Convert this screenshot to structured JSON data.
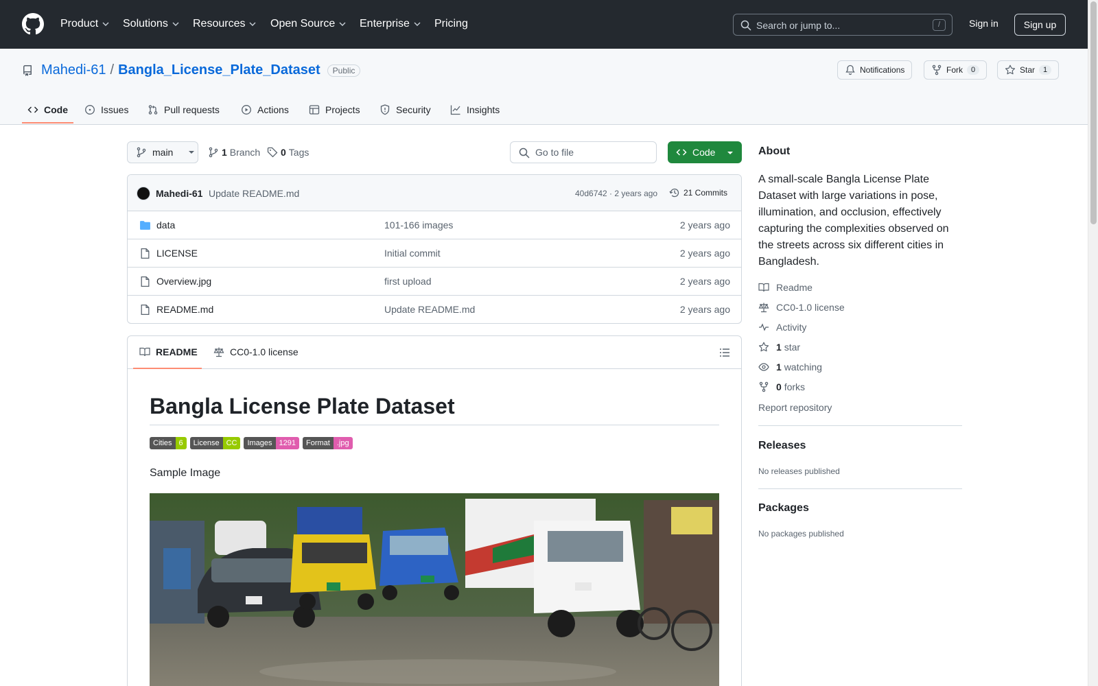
{
  "nav": {
    "items": [
      {
        "label": "Product",
        "dropdown": true
      },
      {
        "label": "Solutions",
        "dropdown": true
      },
      {
        "label": "Resources",
        "dropdown": true
      },
      {
        "label": "Open Source",
        "dropdown": true
      },
      {
        "label": "Enterprise",
        "dropdown": true
      },
      {
        "label": "Pricing",
        "dropdown": false
      }
    ],
    "search_placeholder": "Search or jump to...",
    "search_shortcut": "/",
    "sign_in": "Sign in",
    "sign_up": "Sign up"
  },
  "repo": {
    "owner": "Mahedi-61",
    "separator": "/",
    "name": "Bangla_License_Plate_Dataset",
    "visibility": "Public",
    "notifications_label": "Notifications",
    "fork_label": "Fork",
    "fork_count": "0",
    "star_label": "Star",
    "star_count": "1"
  },
  "tabs": [
    {
      "label": "Code",
      "icon": "code-icon",
      "active": true
    },
    {
      "label": "Issues",
      "icon": "issue-icon"
    },
    {
      "label": "Pull requests",
      "icon": "pull-request-icon"
    },
    {
      "label": "Actions",
      "icon": "play-icon"
    },
    {
      "label": "Projects",
      "icon": "table-icon"
    },
    {
      "label": "Security",
      "icon": "shield-icon"
    },
    {
      "label": "Insights",
      "icon": "graph-icon"
    }
  ],
  "branchbar": {
    "branch": "main",
    "branch_count": "1",
    "branch_label": "Branch",
    "tag_count": "0",
    "tag_label": "Tags",
    "goto_placeholder": "Go to file",
    "code_button": "Code"
  },
  "commit": {
    "author": "Mahedi-61",
    "message": "Update README.md",
    "sha_time": "40d6742 · 2 years ago",
    "commits_label": "21 Commits"
  },
  "files": [
    {
      "type": "folder",
      "name": "data",
      "message": "101-166 images",
      "date": "2 years ago"
    },
    {
      "type": "file",
      "name": "LICENSE",
      "message": "Initial commit",
      "date": "2 years ago"
    },
    {
      "type": "file",
      "name": "Overview.jpg",
      "message": "first upload",
      "date": "2 years ago"
    },
    {
      "type": "file",
      "name": "README.md",
      "message": "Update README.md",
      "date": "2 years ago"
    }
  ],
  "readme": {
    "tab_readme": "README",
    "tab_license": "CC0-1.0 license",
    "title": "Bangla License Plate Dataset",
    "badges": [
      {
        "label": "Cities",
        "value": "6",
        "color": "#4c1"
      },
      {
        "label": "License",
        "value": "CC",
        "color": "#97ca00"
      },
      {
        "label": "Images",
        "value": "1291",
        "color": "#e05d44"
      },
      {
        "label": "Format",
        "value": ".jpg",
        "color": "#e05d44"
      }
    ],
    "sample_label": "Sample Image"
  },
  "about": {
    "title": "About",
    "description": "A small-scale Bangla License Plate Dataset with large variations in pose, illumination, and occlusion, effectively capturing the complexities observed on the streets across six different cities in Bangladesh.",
    "links": {
      "readme": "Readme",
      "license": "CC0-1.0 license",
      "activity": "Activity",
      "stars_count": "1",
      "stars_label": "star",
      "watching_count": "1",
      "watching_label": "watching",
      "forks_count": "0",
      "forks_label": "forks"
    },
    "report": "Report repository",
    "releases_title": "Releases",
    "releases_empty": "No releases published",
    "packages_title": "Packages",
    "packages_empty": "No packages published"
  },
  "colors": {
    "header_bg": "#24292f",
    "link": "#0969da",
    "primary_button": "#1f883d",
    "tab_underline": "#fd8c73"
  }
}
